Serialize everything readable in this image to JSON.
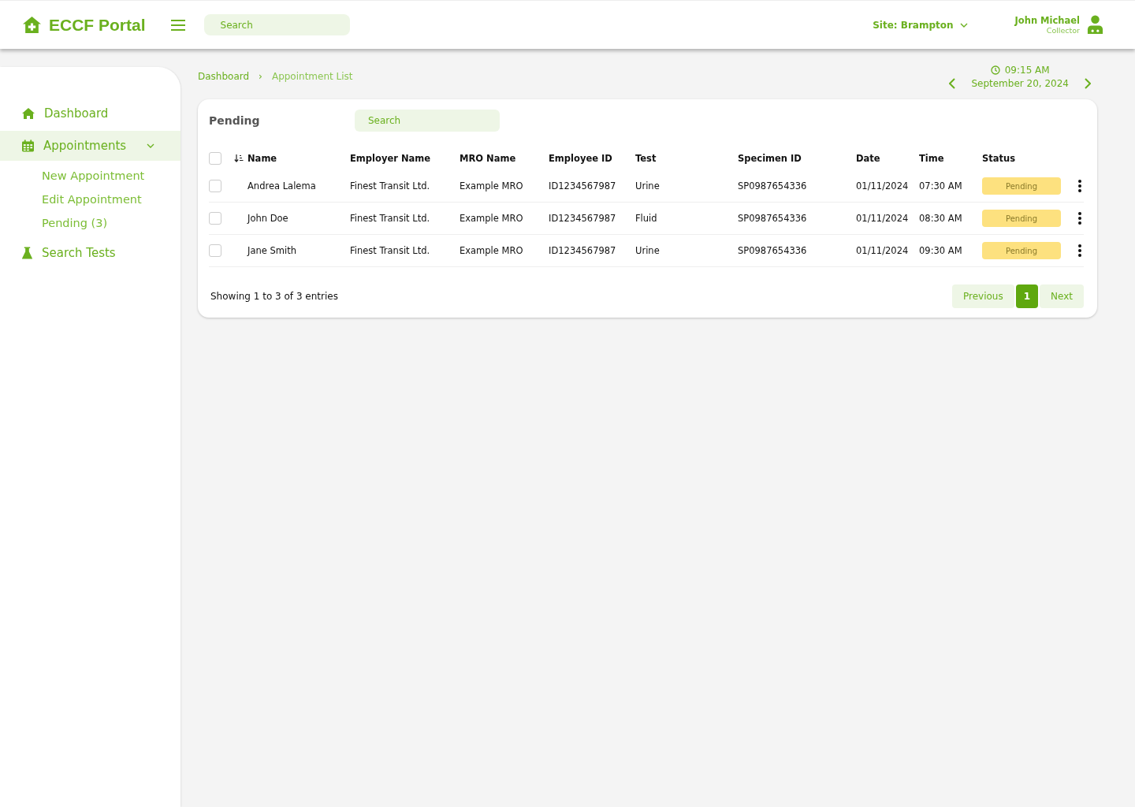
{
  "header": {
    "title": "ECCF Portal",
    "search": {
      "placeholder": "Search"
    },
    "site": "Site: Brampton",
    "user": {
      "name": "John Michael",
      "role": "Collector"
    }
  },
  "sidebar": {
    "items": [
      {
        "label": "Dashboard",
        "kind": "home",
        "selected": false
      },
      {
        "label": "Appointments",
        "kind": "calendar",
        "selected": true,
        "expanded": true,
        "children": [
          {
            "label": "New Appointment"
          },
          {
            "label": "Edit Appointment"
          },
          {
            "label": "Pending (3)"
          }
        ]
      },
      {
        "label": "Search Tests",
        "kind": "flask",
        "selected": false
      }
    ]
  },
  "breadcrumb": [
    {
      "label": "Dashboard",
      "current": false
    },
    {
      "label": "Appointment List",
      "current": true
    }
  ],
  "breadcrumb_separator": "›",
  "clock": {
    "time": "09:15 AM",
    "date": "September 20, 2024"
  },
  "table": {
    "title": "Pending",
    "search": {
      "placeholder": "Search"
    },
    "columns": [
      "Name",
      "Employer Name",
      "MRO Name",
      "Employee ID",
      "Test",
      "Specimen ID",
      "Date",
      "Time",
      "Status"
    ],
    "header_checked": false,
    "rows": [
      {
        "checked": false,
        "cells": [
          "Andrea Lalema",
          "Finest Transit Ltd.",
          "Example MRO",
          "ID1234567987",
          "Urine",
          "SP0987654336",
          "01/11/2024",
          "07:30 AM"
        ],
        "status": "Pending"
      },
      {
        "checked": false,
        "cells": [
          "John Doe",
          "Finest Transit Ltd.",
          "Example MRO",
          "ID1234567987",
          "Fluid",
          "SP0987654336",
          "01/11/2024",
          "08:30 AM"
        ],
        "status": "Pending"
      },
      {
        "checked": false,
        "cells": [
          "Jane Smith",
          "Finest Transit Ltd.",
          "Example MRO",
          "ID1234567987",
          "Urine",
          "SP0987654336",
          "01/11/2024",
          "09:30 AM"
        ],
        "status": "Pending"
      }
    ],
    "summary": "Showing 1 to 3 of 3 entries",
    "pagination": [
      {
        "label": "Previous",
        "kind": "nav",
        "selected": false
      },
      {
        "label": "1",
        "kind": "page",
        "selected": true
      },
      {
        "label": "Next",
        "kind": "nav",
        "selected": false
      }
    ]
  }
}
